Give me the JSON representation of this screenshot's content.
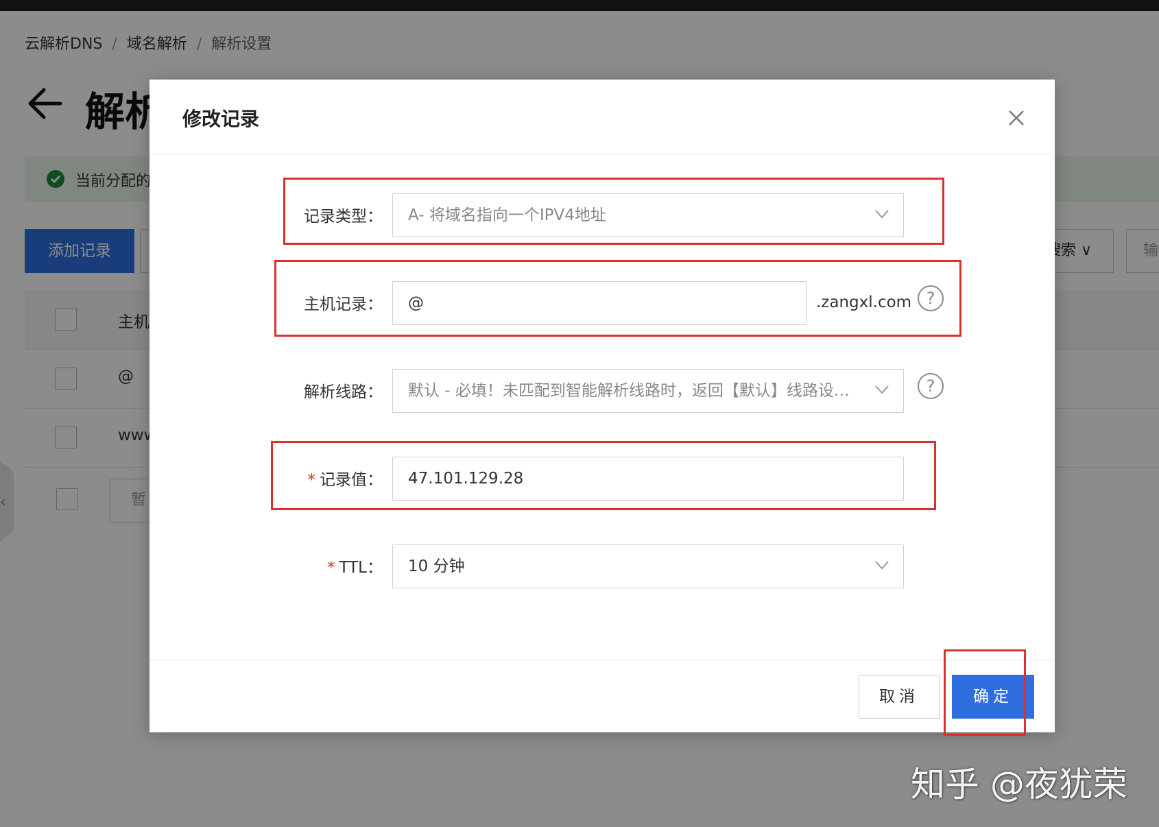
{
  "breadcrumb": {
    "items": [
      "云解析DNS",
      "域名解析",
      "解析设置"
    ],
    "separator": "/"
  },
  "page": {
    "title": "解析",
    "notice_text": "当前分配的"
  },
  "toolbar": {
    "add_label": "添加记录",
    "search_select_label": "搜索",
    "search_input_placeholder": "输"
  },
  "table": {
    "header_first_col": "主机",
    "rows": [
      {
        "host": "@"
      },
      {
        "host": "www"
      }
    ],
    "pager_text": "暂"
  },
  "modal": {
    "title": "修改记录",
    "fields": {
      "record_type": {
        "label": "记录类型：",
        "value": "A- 将域名指向一个IPV4地址"
      },
      "host_record": {
        "label": "主机记录：",
        "value": "@",
        "suffix": ".zangxl.com"
      },
      "line": {
        "label": "解析线路：",
        "value": "默认 - 必填！未匹配到智能解析线路时，返回【默认】线路设置结果"
      },
      "record_value": {
        "label": "记录值：",
        "value": "47.101.129.28"
      },
      "ttl": {
        "label": "TTL：",
        "value": "10 分钟"
      }
    },
    "required_mark": "*",
    "help_glyph": "?",
    "cancel_label": "取消",
    "ok_label": "确定"
  },
  "watermark": "知乎 @夜犹荣",
  "colors": {
    "primary": "#2f6ede",
    "highlight": "#d9322b",
    "success": "#1b8a3c",
    "required": "#d0342c"
  },
  "icons": {
    "back": "arrow-left-icon",
    "close": "close-icon",
    "chevron": "chevron-down-icon",
    "help": "question-circle-icon",
    "success": "check-circle-icon"
  }
}
